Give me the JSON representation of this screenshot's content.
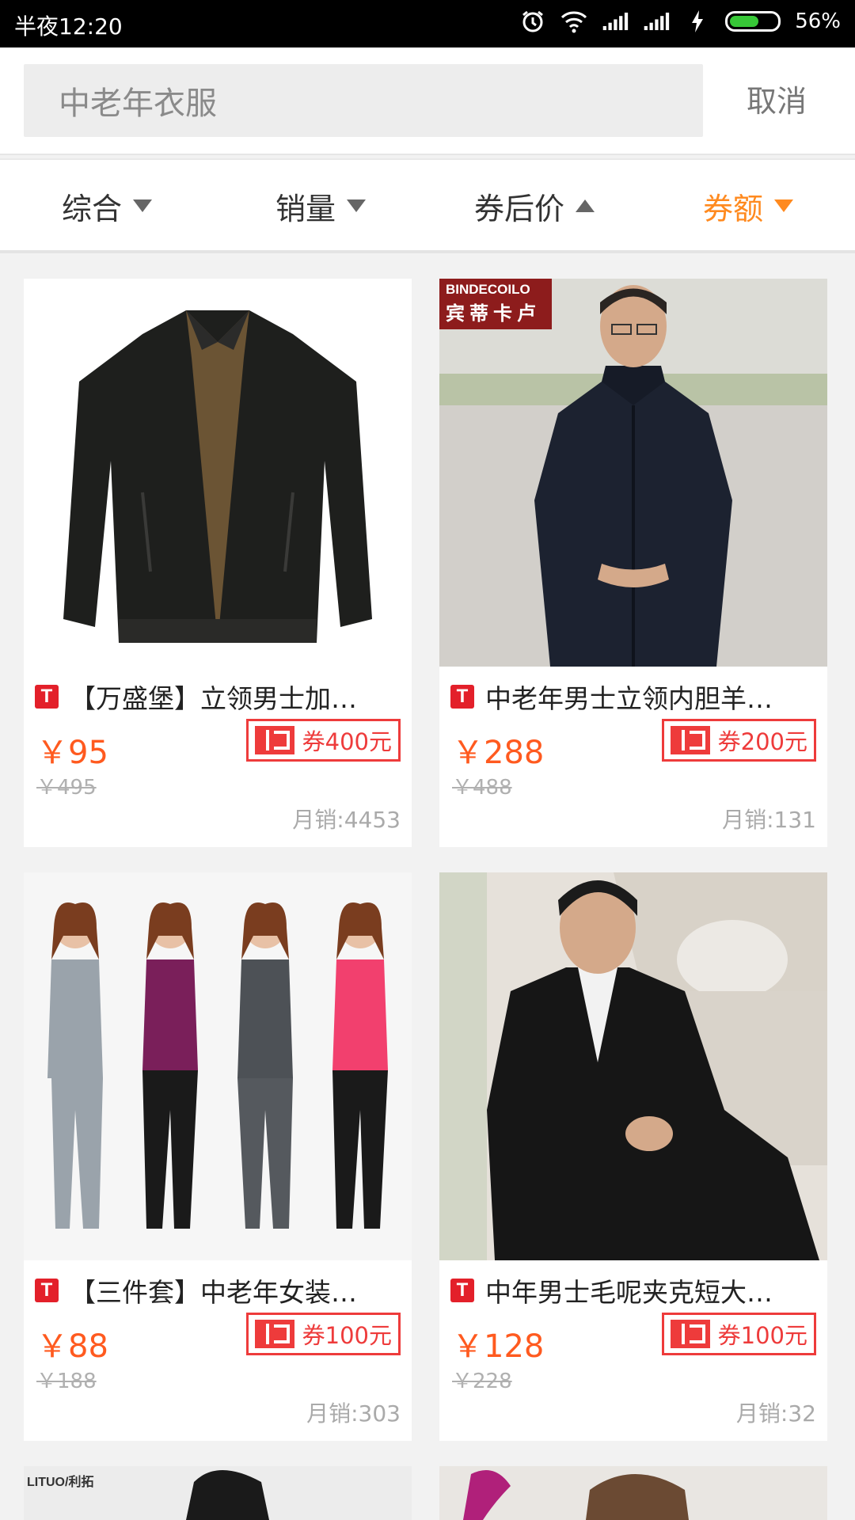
{
  "status_bar": {
    "time": "半夜12:20",
    "battery": "56%"
  },
  "search": {
    "query": "中老年衣服",
    "cancel_label": "取消"
  },
  "sort": [
    {
      "label": "综合",
      "arrow": "down",
      "active": false
    },
    {
      "label": "销量",
      "arrow": "down",
      "active": false
    },
    {
      "label": "券后价",
      "arrow": "up",
      "active": false
    },
    {
      "label": "券额",
      "arrow": "down",
      "active": true
    }
  ],
  "colors": {
    "accent": "#ff8a1f",
    "price": "#ff5a1f",
    "coupon": "#ee3b3b",
    "tmall": "#e3202a"
  },
  "products": [
    {
      "title": "【万盛堡】立领男士加…",
      "price": "￥95",
      "original_price": "￥495",
      "coupon": "券400元",
      "sales": "月销:4453",
      "image": "black-leather-jacket"
    },
    {
      "title": "中老年男士立领内胆羊…",
      "price": "￥288",
      "original_price": "￥488",
      "coupon": "券200元",
      "sales": "月销:131",
      "image": "man-in-navy-wool-coat",
      "brand": "BINDECOILO",
      "brand_cn": "宾蒂卡卢"
    },
    {
      "title": "【三件套】中老年女装…",
      "price": "￥88",
      "original_price": "￥188",
      "coupon": "券100元",
      "sales": "月销:303",
      "image": "four-women-tracksuits"
    },
    {
      "title": "中年男士毛呢夹克短大…",
      "price": "￥128",
      "original_price": "￥228",
      "coupon": "券100元",
      "sales": "月销:32",
      "image": "man-on-sofa-black-jacket"
    }
  ],
  "partial_products": [
    {
      "brand": "LITUO/利拓"
    },
    {
      "image": "woman-portrait"
    }
  ]
}
